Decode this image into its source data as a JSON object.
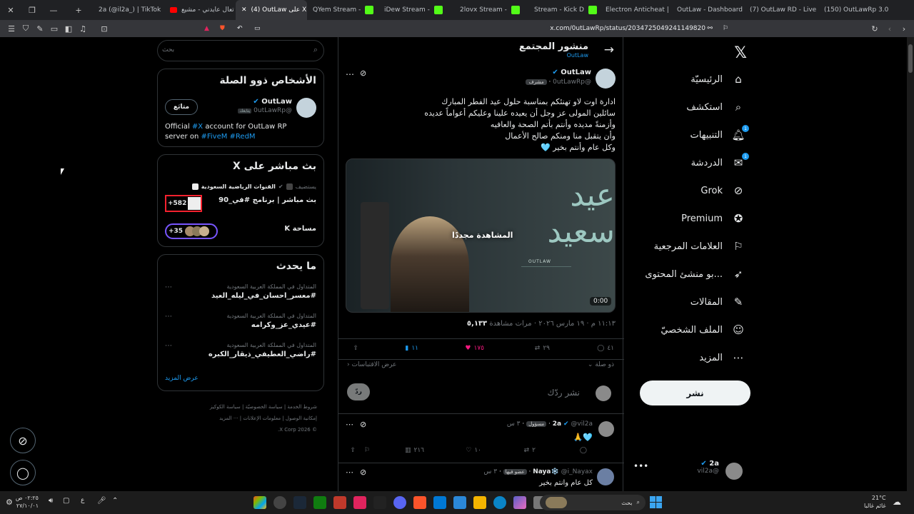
{
  "tabs": [
    {
      "label": "2a (@il2a_) | TikTok",
      "active": false
    },
    {
      "label": "تعال عايدني - مشيع",
      "active": false
    },
    {
      "label": "(4) OutLaw على X",
      "active": true
    },
    {
      "label": "QYem Stream -",
      "active": false
    },
    {
      "label": "iDew Stream -",
      "active": false
    },
    {
      "label": "2lovx Stream -",
      "active": false
    },
    {
      "label": "Stream - Kick D",
      "active": false
    },
    {
      "label": "Electron Anticheat |",
      "active": false
    },
    {
      "label": "OutLaw - Dashboard",
      "active": false
    },
    {
      "label": "(7) OutLaw RD - Live",
      "active": false
    },
    {
      "label": "(150) OutLawRp 3.0",
      "active": false
    }
  ],
  "url": "x.com/0utLawRp/status/2034725049241149820",
  "nav": {
    "home": "الرئيسيّة",
    "explore": "استكشف",
    "notifications": "التنبيهات",
    "notifications_badge": "1",
    "chat": "الدردشة",
    "chat_badge": "1",
    "grok": "Grok",
    "premium": "Premium",
    "bookmarks": "العلامات المرجعية",
    "creators": "...بو منشئ المحتوى",
    "articles": "المقالات",
    "profile": "الملف الشخصيّ",
    "more": "المزيد",
    "post_button": "نشر",
    "account_name": "2a",
    "account_handle": "@vil2a"
  },
  "main": {
    "header_title": "منشور المجتمع",
    "header_sub": "OutLaw",
    "author_name": "OutLaw",
    "author_handle": "@0utLawRp",
    "author_role": "مشرف",
    "post_lines": [
      "ادارة اوت لاو تهنئكم بمناسبة حلول عيد الفطر المبارك",
      "سائلين المولى عز وجل أن يعيده علينا وعليكم أعواماً عديده",
      "وأزمنةً مديده وأنتم بأتم الصحة والعافيه",
      "وأن يتقبل منا ومنكم صالح الأعمال",
      "وكل عام وأنتم بخير 🩵"
    ],
    "video_overlay": "المشاهدة مجددًا",
    "video_time": "0:00",
    "video_text": "عيد سعيد",
    "video_brand": "OUTLAW",
    "meta_time": "١١:١٣ م · ١٩ مارس ٢٠٢٦ · مرات مشاهدة",
    "meta_views": "٥,١٣٣",
    "stats": {
      "replies": "٤١",
      "reposts": "٢٩",
      "likes": "١٧٥",
      "bookmarks": "١١"
    },
    "related": "ذو صلة",
    "quotes": "عرض الاقتباسات",
    "reply_placeholder": "نشر ردّك",
    "reply_button": "ردّ",
    "reply1": {
      "name": "2a",
      "handle": "@vil2a",
      "role": "مسؤول",
      "time": "٣ س",
      "text": "🩵🙏",
      "replies": "",
      "reposts": "٢",
      "likes": "١٠",
      "views": "٢١٦"
    },
    "reply2": {
      "name": "Naya❄️",
      "handle": "@i_Nayax",
      "role": "عضو فيها",
      "time": "٣ س",
      "text": "كل عام وانتم بخير"
    }
  },
  "sidebar": {
    "search_placeholder": "بحث",
    "related_title": "الأشخاص ذوو الصلة",
    "related_name": "OutLaw",
    "related_handle": "@0utLawRp",
    "related_tag": "يتابعك",
    "related_follow": "متابَع",
    "related_bio_pre": "Official ",
    "related_bio_x": "#X",
    "related_bio_mid": " account for OutLaw RP server on ",
    "related_bio_fivem": "#FiveM",
    "related_bio_redm": "#RedM",
    "live_title": "بث مباشر على X",
    "live_host_pre": "يستضيف",
    "live_host": "القنوات الرياضية السعودية",
    "live_show": "بث مباشر | برنامج #في_90",
    "live_count": "+582",
    "space_label": "مساحة K",
    "space_count": "+35",
    "trends_title": "ما يحدث",
    "trends": [
      {
        "context": "المتداول في المملكة العربية السعودية",
        "tag": "#معسر_احسان_في_ليله_العيد"
      },
      {
        "context": "المتداول في المملكة العربية السعودية",
        "tag": "#عيدي_عز_وكرامه"
      },
      {
        "context": "المتداول في المملكة العربية السعودية",
        "tag": "#راضي_العطيفي_ذيقار_الكبره"
      }
    ],
    "show_more": "عرض المزيد",
    "footer": [
      "شروط الخدمة",
      "سياسة الخصوصيّة",
      "سياسة الكوكيز",
      "إمكانية الوصول",
      "معلومات الإعلانات",
      "··· المزيد",
      "© 2026 X Corp."
    ]
  },
  "taskbar": {
    "search": "بحث",
    "time": "٠٢:٢٥ ص",
    "date": "٢٧/١٠/٠١",
    "lang": "ع",
    "weather_temp": "21°C",
    "weather_desc": "غائم غالبا"
  }
}
